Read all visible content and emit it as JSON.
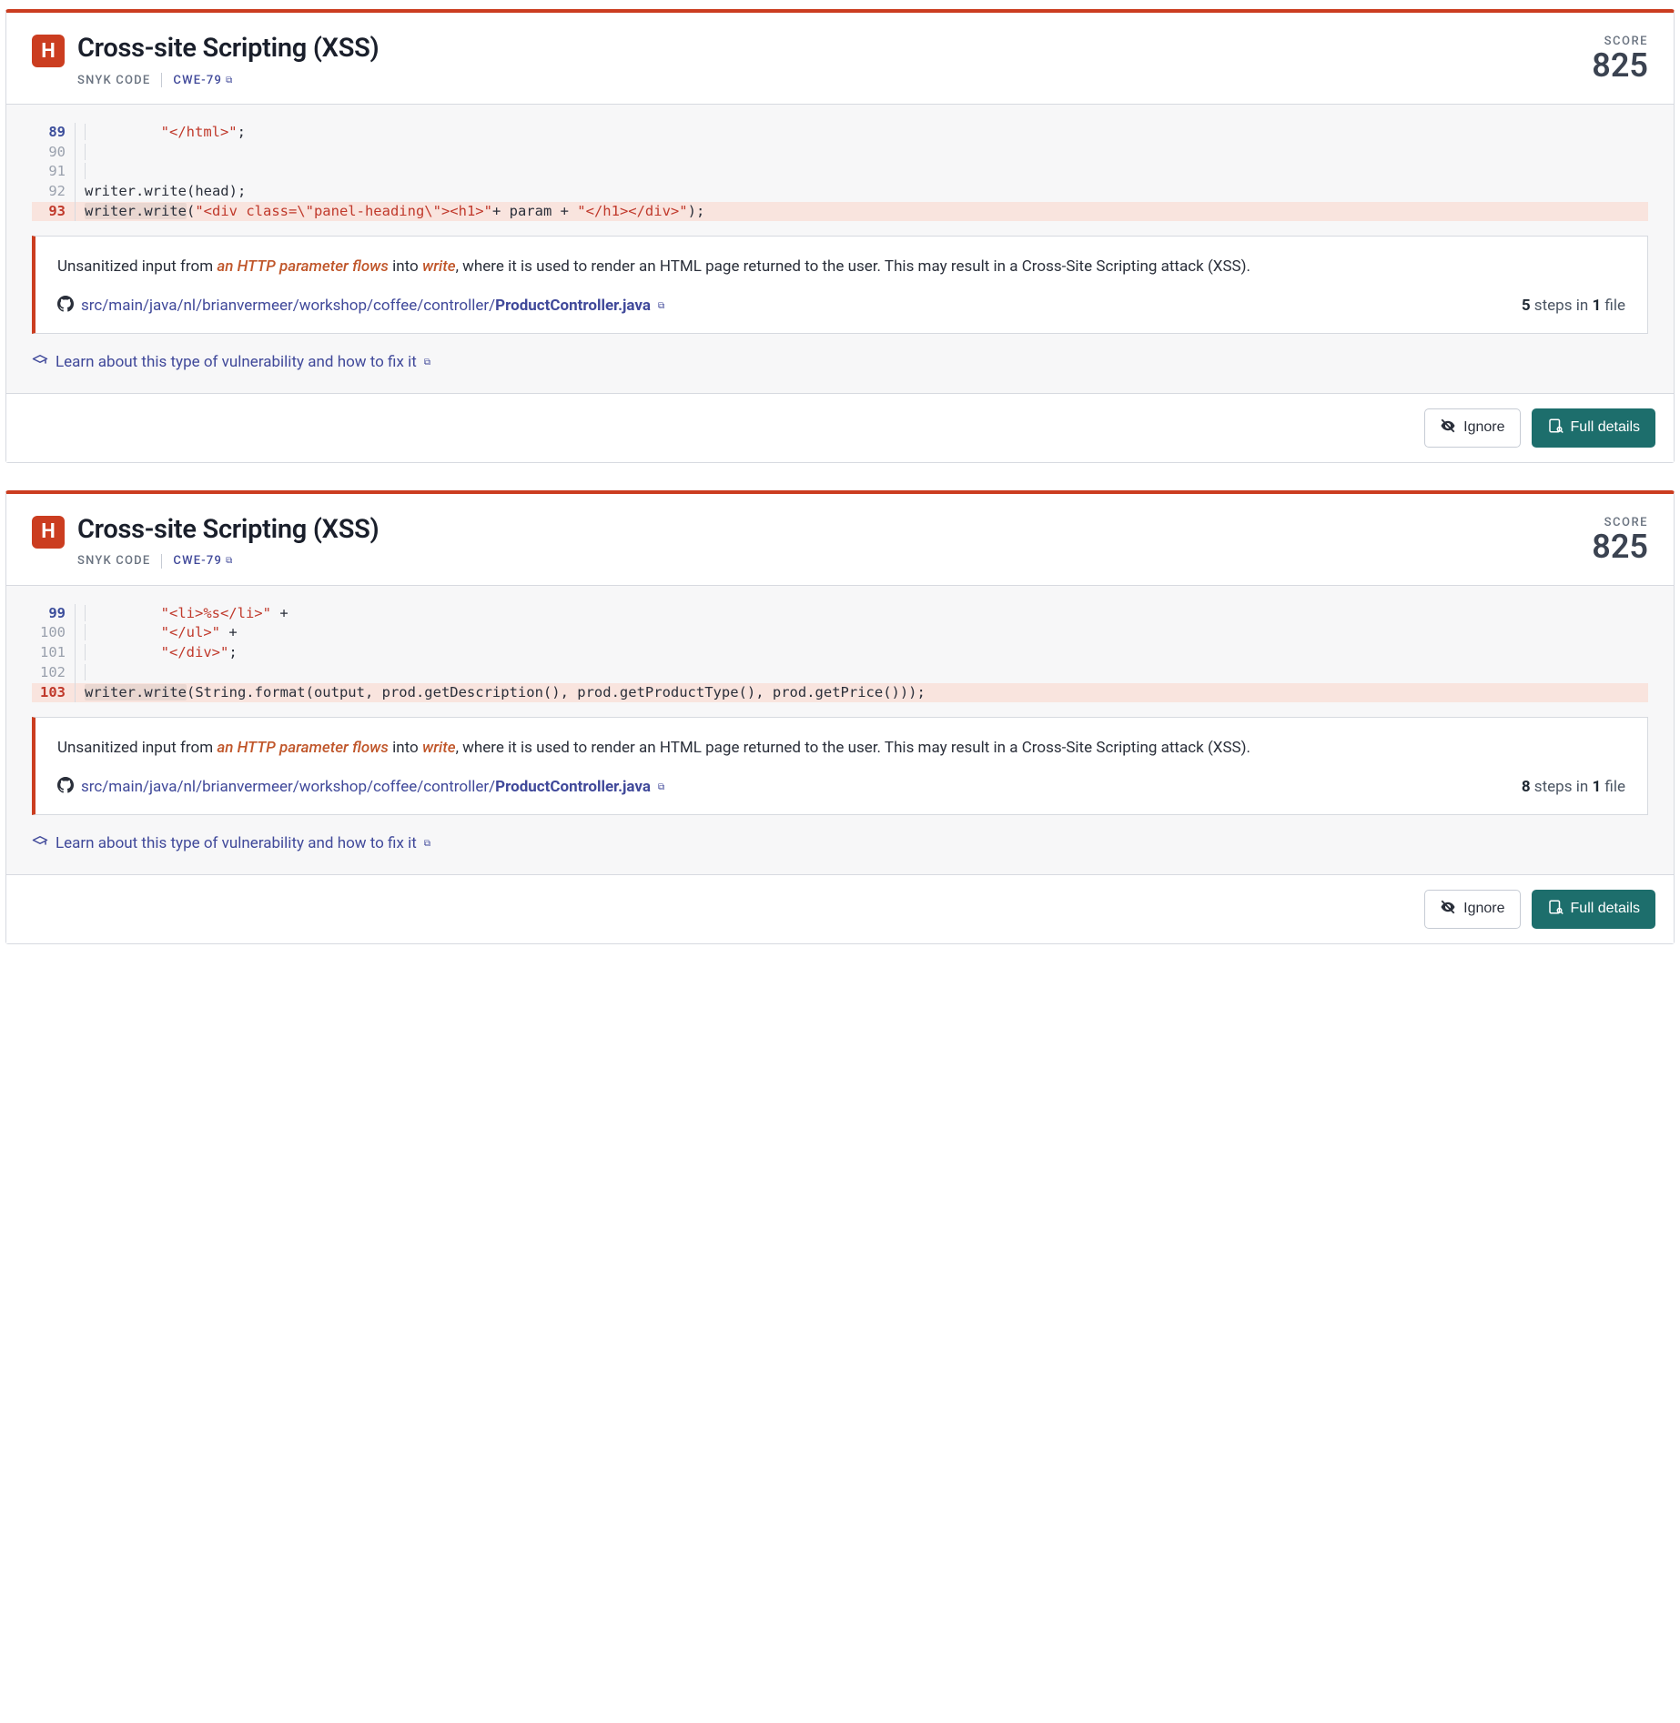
{
  "cards": [
    {
      "severity": "H",
      "title": "Cross-site Scripting (XSS)",
      "source": "SNYK CODE",
      "cwe": "CWE-79",
      "score_label": "SCORE",
      "score_value": "825",
      "code": [
        {
          "n": "89",
          "g": "active",
          "indent": true,
          "segs": [
            {
              "t": "plain",
              "v": "        "
            },
            {
              "t": "str",
              "v": "\"</html>\""
            },
            {
              "t": "plain",
              "v": ";"
            }
          ]
        },
        {
          "n": "90",
          "g": "",
          "indent": true,
          "segs": []
        },
        {
          "n": "91",
          "g": "",
          "indent": true,
          "segs": []
        },
        {
          "n": "92",
          "g": "",
          "indent": false,
          "segs": [
            {
              "t": "plain",
              "v": "writer.write(head);"
            }
          ]
        },
        {
          "n": "93",
          "g": "vuln",
          "vuln": true,
          "indent": false,
          "segs": [
            {
              "t": "ul",
              "v": "writer.write"
            },
            {
              "t": "plain",
              "v": "("
            },
            {
              "t": "str",
              "v": "\"<div class=\\\"panel-heading\\\"><h1>\""
            },
            {
              "t": "plain",
              "v": "+ param + "
            },
            {
              "t": "str",
              "v": "\"</h1></div>\""
            },
            {
              "t": "plain",
              "v": ");"
            }
          ]
        }
      ],
      "explain": {
        "pre": "Unsanitized input from ",
        "hl1": "an HTTP parameter flows",
        "mid": " into ",
        "hl2": "write",
        "post": ", where it is used to render an HTML page returned to the user. This may result in a Cross-Site Scripting attack (XSS)."
      },
      "file": {
        "dir": "src/main/java/nl/brianvermeer/workshop/coffee/controller/",
        "name": "ProductController.java"
      },
      "steps": {
        "n": "5",
        "word": "steps in",
        "files": "1",
        "fword": "file"
      },
      "learn": "Learn about this type of vulnerability and how to fix it",
      "ignore": "Ignore",
      "details": "Full details"
    },
    {
      "severity": "H",
      "title": "Cross-site Scripting (XSS)",
      "source": "SNYK CODE",
      "cwe": "CWE-79",
      "score_label": "SCORE",
      "score_value": "825",
      "code": [
        {
          "n": "99",
          "g": "active",
          "indent": true,
          "segs": [
            {
              "t": "plain",
              "v": "        "
            },
            {
              "t": "str",
              "v": "\"<li>%s</li>\""
            },
            {
              "t": "plain",
              "v": " +"
            }
          ]
        },
        {
          "n": "100",
          "g": "",
          "indent": true,
          "segs": [
            {
              "t": "plain",
              "v": "        "
            },
            {
              "t": "str",
              "v": "\"</ul>\""
            },
            {
              "t": "plain",
              "v": " +"
            }
          ]
        },
        {
          "n": "101",
          "g": "",
          "indent": true,
          "segs": [
            {
              "t": "plain",
              "v": "        "
            },
            {
              "t": "str",
              "v": "\"</div>\""
            },
            {
              "t": "plain",
              "v": ";"
            }
          ]
        },
        {
          "n": "102",
          "g": "",
          "indent": true,
          "segs": []
        },
        {
          "n": "103",
          "g": "vuln",
          "vuln": true,
          "indent": false,
          "segs": [
            {
              "t": "ul",
              "v": "writer.write"
            },
            {
              "t": "plain",
              "v": "(String.format(output, prod.getDescription(), prod.getProductType(), prod.getPrice()));"
            }
          ]
        }
      ],
      "explain": {
        "pre": "Unsanitized input from ",
        "hl1": "an HTTP parameter flows",
        "mid": " into ",
        "hl2": "write",
        "post": ", where it is used to render an HTML page returned to the user. This may result in a Cross-Site Scripting attack (XSS)."
      },
      "file": {
        "dir": "src/main/java/nl/brianvermeer/workshop/coffee/controller/",
        "name": "ProductController.java"
      },
      "steps": {
        "n": "8",
        "word": "steps in",
        "files": "1",
        "fword": "file"
      },
      "learn": "Learn about this type of vulnerability and how to fix it",
      "ignore": "Ignore",
      "details": "Full details"
    }
  ]
}
